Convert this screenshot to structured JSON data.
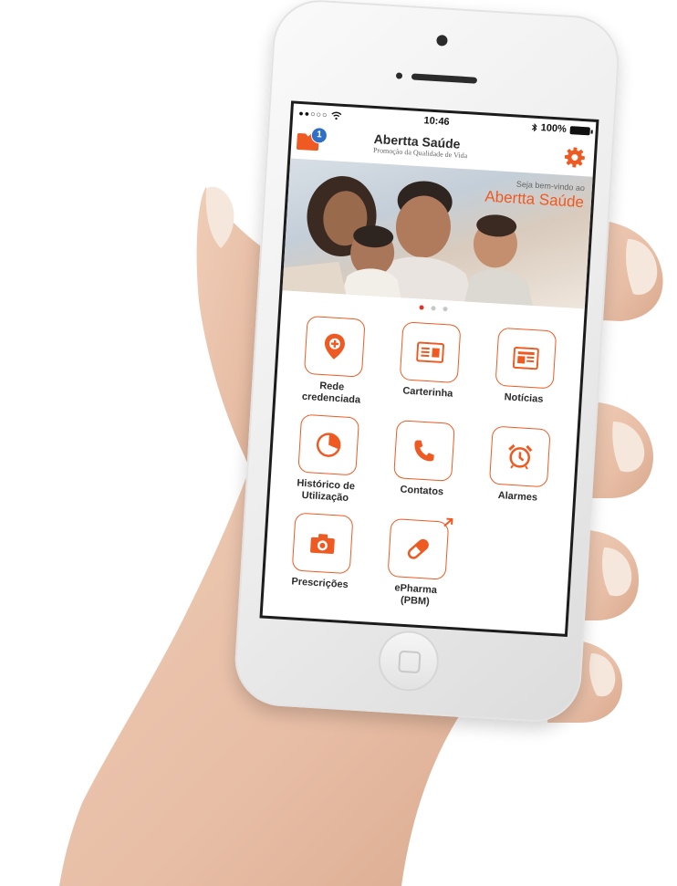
{
  "status_bar": {
    "signal": "●●○○○",
    "time": "10:46",
    "battery": "100%"
  },
  "header": {
    "title": "Abertta Saúde",
    "subtitle": "Promoção da Qualidade de Vida",
    "unread_count": "1",
    "icons": {
      "mail": "mail-icon",
      "settings": "gear-icon"
    }
  },
  "banner": {
    "welcome": "Seja bem-vindo ao",
    "brand": "Abertta Saúde"
  },
  "carousel": {
    "total": 3,
    "active": 1
  },
  "menu": [
    {
      "label": "Rede\ncredenciada",
      "icon": "location-pin-icon"
    },
    {
      "label": "Carterinha",
      "icon": "id-card-icon"
    },
    {
      "label": "Notícias",
      "icon": "newspaper-icon"
    },
    {
      "label": "Histórico de\nUtilização",
      "icon": "pie-chart-icon"
    },
    {
      "label": "Contatos",
      "icon": "phone-icon"
    },
    {
      "label": "Alarmes",
      "icon": "alarm-clock-icon"
    },
    {
      "label": "Prescrições",
      "icon": "camera-icon"
    },
    {
      "label": "ePharma\n(PBM)",
      "icon": "pill-icon"
    }
  ],
  "colors": {
    "accent": "#ef5a22",
    "badge": "#2f6fc6",
    "dot_active": "#e0352b"
  }
}
